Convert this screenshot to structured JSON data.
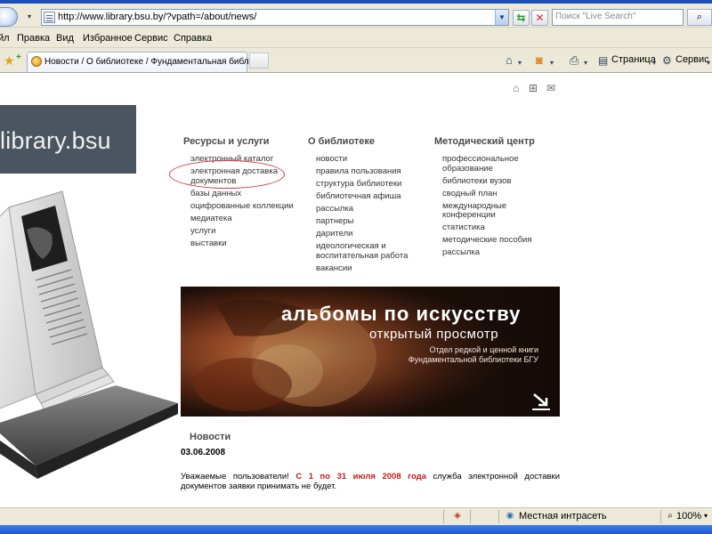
{
  "browser": {
    "address": "http://www.library.bsu.by/?vpath=/about/news/",
    "search_placeholder": "Поиск \"Live Search\"",
    "menu": [
      "йл",
      "Правка",
      "Вид",
      "Избранное",
      "Сервис",
      "Справка"
    ],
    "tab_title": "Новости / О библиотеке / Фундаментальная библи...",
    "toolbar": {
      "page_label": "Страница",
      "service_label": "Сервис"
    }
  },
  "site": {
    "logo": "library.bsu",
    "columns": [
      {
        "title": "Ресурсы и услуги",
        "items": [
          [
            "электронный каталог"
          ],
          [
            "электронная доставка",
            "документов"
          ],
          [
            "базы данных"
          ],
          [
            "оцифрованные коллекции"
          ],
          [
            "медиатека"
          ],
          [
            "услуги"
          ],
          [
            "выставки"
          ]
        ]
      },
      {
        "title": "О библиотеке",
        "items": [
          [
            "новости"
          ],
          [
            "правила пользования"
          ],
          [
            "структура библиотеки"
          ],
          [
            "библиотечная афиша"
          ],
          [
            "рассылка"
          ],
          [
            "партнеры"
          ],
          [
            "дарители"
          ],
          [
            "идеологическая и",
            "воспитательная работа"
          ],
          [
            "вакансии"
          ]
        ]
      },
      {
        "title": "Методический центр",
        "items": [
          [
            "профессиональное",
            "образование"
          ],
          [
            "библиотеки вузов"
          ],
          [
            "сводный план"
          ],
          [
            "международные",
            "конференции"
          ],
          [
            "статистика"
          ],
          [
            "методические пособия"
          ],
          [
            "рассылка"
          ]
        ]
      }
    ],
    "banner": {
      "title": "альбомы по искусству",
      "subtitle": "открытый просмотр",
      "note_line1": "Отдел редкой и ценной книги",
      "note_line2": "Фундаментальной библиотеки БГУ"
    },
    "news": {
      "heading": "Новости",
      "date": "03.06.2008",
      "text_before": "Уважаемые пользователи!",
      "text_highlight": "С 1 по 31 июля 2008 года",
      "text_after": "служба электронной доставки документов заявки принимать не будет."
    }
  },
  "status": {
    "zone": "Местная интрасеть",
    "zoom": "100%"
  },
  "colors": {
    "chrome": "#ece9d8",
    "highlight": "#c41a1a",
    "logo_bg": "#4a5560",
    "ellipse": "#d63a3a"
  }
}
